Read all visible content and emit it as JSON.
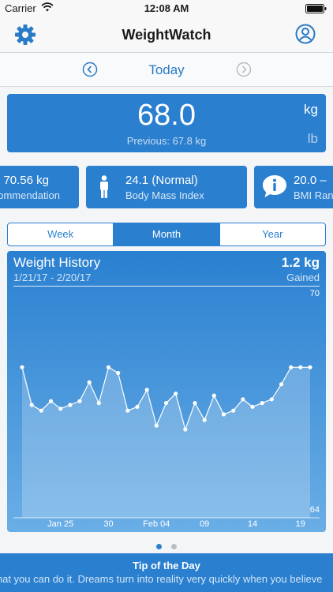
{
  "status_bar": {
    "carrier": "Carrier",
    "time": "12:08 AM"
  },
  "nav": {
    "title": "WeightWatch",
    "left_icon": "gear-icon",
    "right_icon": "user-icon"
  },
  "date_nav": {
    "label": "Today"
  },
  "current": {
    "value": "68.0",
    "previous": "Previous: 67.8 kg",
    "unit_primary": "kg",
    "unit_secondary": "lb"
  },
  "metrics": [
    {
      "value": "70.56 kg",
      "label": "Recommendation"
    },
    {
      "value": "24.1 (Normal)",
      "label": "Body Mass Index"
    },
    {
      "value": "20.0 –",
      "label": "BMI Range"
    }
  ],
  "periods": [
    {
      "label": "Week",
      "active": false
    },
    {
      "label": "Month",
      "active": true
    },
    {
      "label": "Year",
      "active": false
    }
  ],
  "history": {
    "title": "Weight History",
    "range": "1/21/17 - 2/20/17",
    "change": "1.2 kg",
    "change_label": "Gained"
  },
  "chart_data": {
    "type": "area",
    "title": "Weight History",
    "x": [
      "1/21",
      "1/22",
      "1/23",
      "1/24",
      "1/25",
      "1/26",
      "1/27",
      "1/28",
      "1/29",
      "1/30",
      "1/31",
      "2/1",
      "2/2",
      "2/3",
      "2/4",
      "2/5",
      "2/6",
      "2/7",
      "2/8",
      "2/9",
      "2/10",
      "2/11",
      "2/12",
      "2/13",
      "2/14",
      "2/15",
      "2/16",
      "2/17",
      "2/18",
      "2/19",
      "2/20"
    ],
    "values": [
      68.0,
      67.0,
      66.85,
      67.1,
      66.9,
      67.0,
      67.1,
      67.6,
      67.05,
      68.0,
      67.85,
      66.85,
      66.95,
      67.4,
      66.45,
      67.05,
      67.3,
      66.35,
      67.05,
      66.6,
      67.25,
      66.75,
      66.85,
      67.15,
      66.95,
      67.05,
      67.15,
      67.55,
      68.0,
      68.0,
      68.0
    ],
    "series": [
      {
        "values": [
          68.0,
          67.0,
          66.85,
          67.1,
          66.9,
          67.0,
          67.1,
          67.6,
          67.05,
          68.0,
          67.85,
          66.85,
          66.95,
          67.4,
          66.45,
          67.05,
          67.3,
          66.35,
          67.05,
          66.6,
          67.25,
          66.75,
          66.85,
          67.15,
          66.95,
          67.05,
          67.15,
          67.55,
          68.0,
          68.0,
          68.0
        ]
      }
    ],
    "xticks": [
      {
        "index": 4,
        "label": "Jan 25"
      },
      {
        "index": 9,
        "label": "30"
      },
      {
        "index": 14,
        "label": "Feb 04"
      },
      {
        "index": 19,
        "label": "09"
      },
      {
        "index": 24,
        "label": "14"
      },
      {
        "index": 29,
        "label": "19"
      }
    ],
    "ylim": [
      64,
      70
    ],
    "yticks": [
      "70",
      "64"
    ],
    "grid": false,
    "colors": {
      "line": "#ffffff",
      "fill": "#ffffff"
    }
  },
  "pager": {
    "pages": 2,
    "active": 0
  },
  "tip": {
    "title": "Tip of the Day",
    "text": "Believe that you can do it. Dreams turn into reality very quickly when you believe"
  },
  "colors": {
    "accent": "#2a7fcf",
    "nav_icon": "#2a7bc7",
    "date_arrow_inactive": "#b9bec4",
    "page_dot_active": "#2a7fcf",
    "page_dot_inactive": "#b9bec4"
  }
}
